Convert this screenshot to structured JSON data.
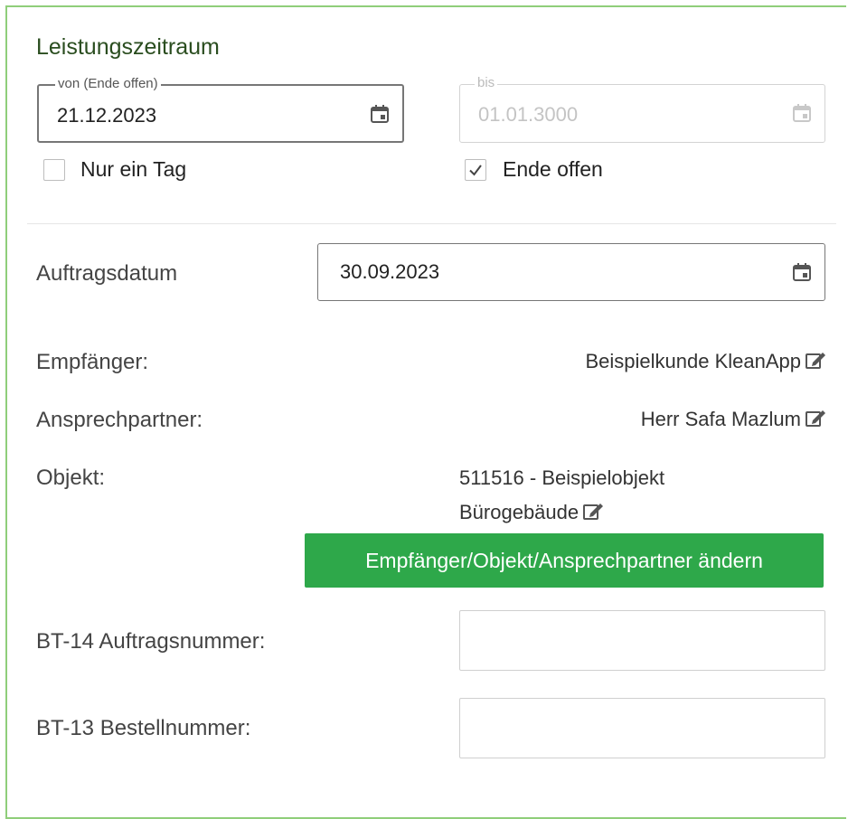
{
  "service_period": {
    "title": "Leistungszeitraum",
    "from": {
      "legend": "von (Ende offen)",
      "value": "21.12.2023"
    },
    "to": {
      "legend": "bis",
      "value": "01.01.3000"
    },
    "only_one_day": {
      "label": "Nur ein Tag",
      "checked": false
    },
    "open_end": {
      "label": "Ende offen",
      "checked": true
    }
  },
  "order_date": {
    "label": "Auftragsdatum",
    "value": "30.09.2023"
  },
  "recipient": {
    "label": "Empfänger:",
    "value": "Beispielkunde KleanApp"
  },
  "contact": {
    "label": "Ansprechpartner:",
    "value": "Herr Safa Mazlum"
  },
  "object": {
    "label": "Objekt:",
    "value_line1": "511516 - Beispielobjekt",
    "value_line2": "Bürogebäude"
  },
  "change_button": {
    "label": "Empfänger/Objekt/Ansprechpartner ändern",
    "color": "#2ea84a"
  },
  "order_number": {
    "label": "BT-14 Auftragsnummer:",
    "value": ""
  },
  "purchase_number": {
    "label": "BT-13 Bestellnummer:",
    "value": ""
  },
  "colors": {
    "accent_border": "#8fce7a",
    "title": "#2a4d1f"
  }
}
